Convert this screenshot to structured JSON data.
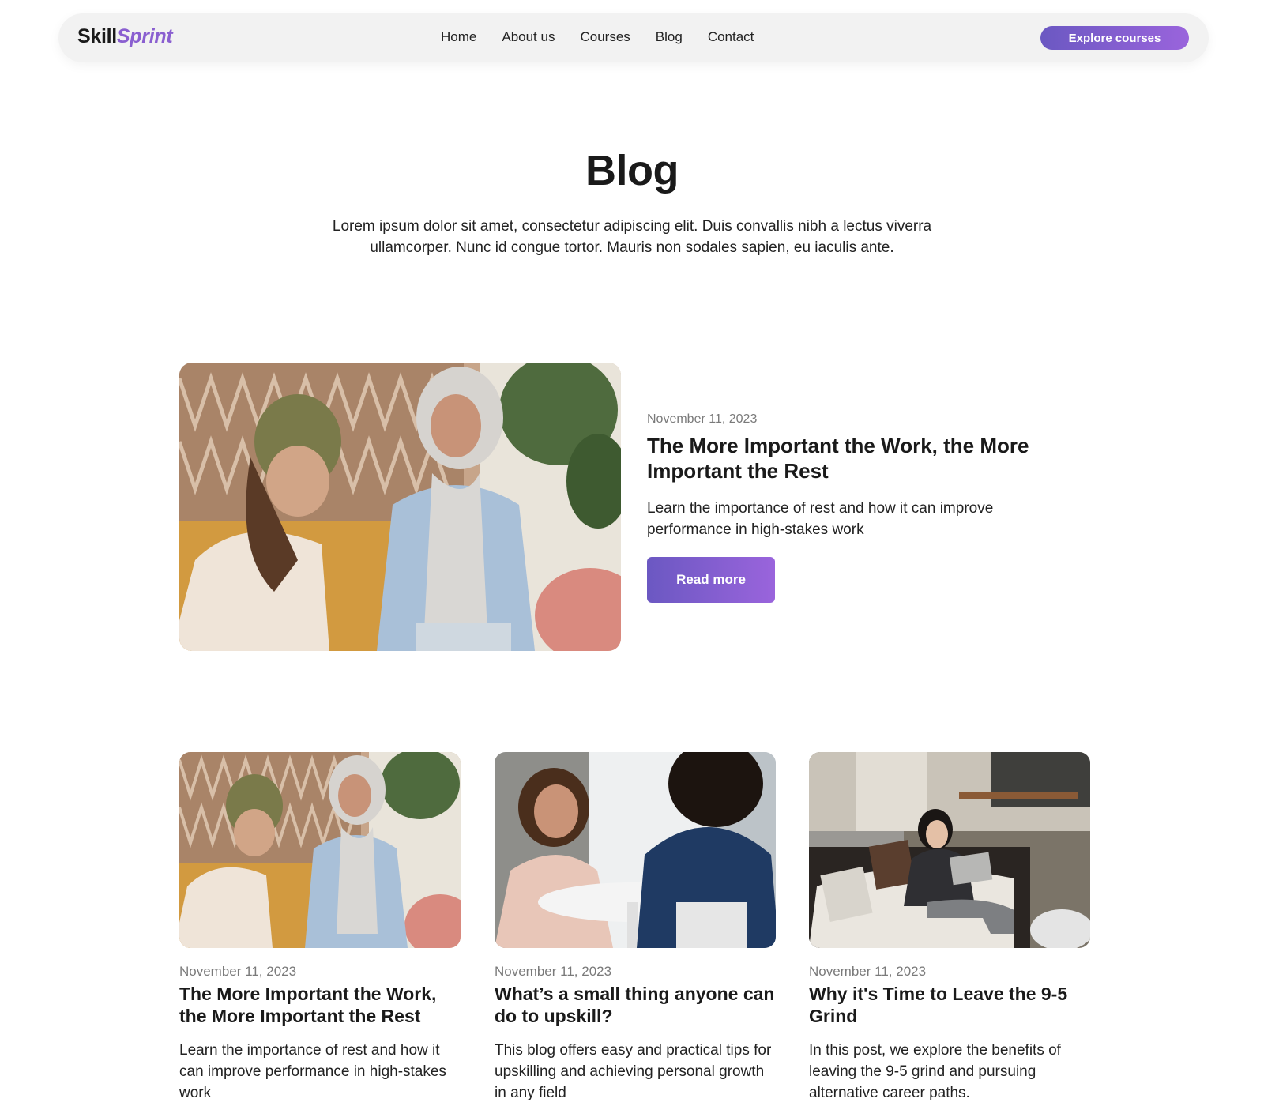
{
  "brand": {
    "part1": "Skill",
    "part2": "Sprint"
  },
  "nav": {
    "links": [
      "Home",
      "About us",
      "Courses",
      "Blog",
      "Contact"
    ],
    "cta": "Explore courses"
  },
  "hero": {
    "title": "Blog",
    "subtitle": "Lorem ipsum dolor sit amet, consectetur adipiscing elit. Duis convallis nibh a lectus viverra ullamcorper. Nunc id congue tortor. Mauris non sodales sapien, eu iaculis ante."
  },
  "featured": {
    "date": "November 11, 2023",
    "title": "The More Important the Work, the More Important the Rest",
    "description": "Learn the importance of rest and how it can improve performance in high-stakes work",
    "button": "Read more"
  },
  "posts": [
    {
      "date": "November 11, 2023",
      "title": "The More Important the Work, the More Important the Rest",
      "description": "Learn the importance of rest and how it can improve performance in high-stakes work"
    },
    {
      "date": "November 11, 2023",
      "title": "What’s a small thing anyone can do to upskill?",
      "description": "This blog offers easy and practical tips for upskilling and achieving personal growth in any field"
    },
    {
      "date": "November 11, 2023",
      "title": "Why it's Time to Leave the 9-5 Grind",
      "description": "In this post, we explore the benefits of leaving the 9-5 grind and pursuing alternative career paths."
    }
  ],
  "colors": {
    "accent_start": "#6b58c2",
    "accent_end": "#9a64dc",
    "nav_bg": "#f2f2f2"
  }
}
